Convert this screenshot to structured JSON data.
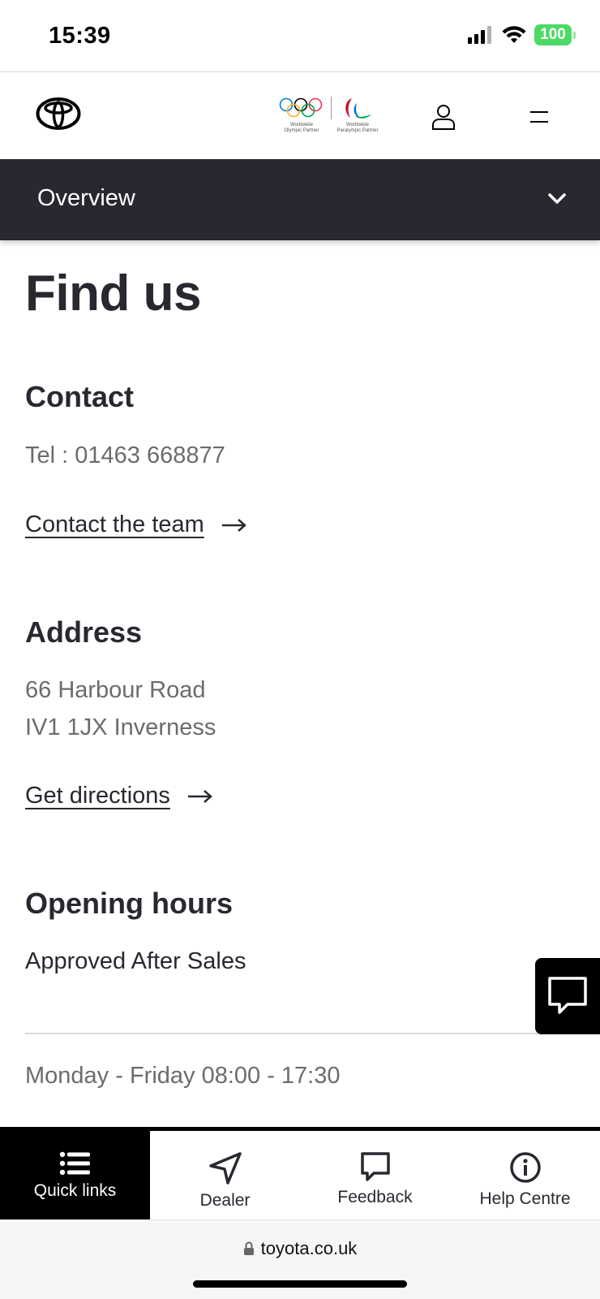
{
  "status_bar": {
    "time": "15:39",
    "battery": "100"
  },
  "header": {
    "olympic_caption_1": "Worldwide",
    "olympic_caption_2": "Olympic Partner",
    "paralympic_caption_1": "Worldwide",
    "paralympic_caption_2": "Paralympic Partner"
  },
  "overview": {
    "label": "Overview"
  },
  "page": {
    "title": "Find us",
    "contact": {
      "heading": "Contact",
      "tel": "Tel : 01463 668877",
      "link": "Contact the team"
    },
    "address": {
      "heading": "Address",
      "line1": "66 Harbour Road",
      "line2": "IV1 1JX Inverness",
      "link": "Get directions"
    },
    "opening_hours": {
      "heading": "Opening hours",
      "department": "Approved After Sales",
      "weekday_hours": "Monday - Friday 08:00 - 17:30"
    }
  },
  "bottom_nav": [
    {
      "label": "Quick links",
      "icon": "list-icon",
      "active": true
    },
    {
      "label": "Dealer",
      "icon": "navigation-arrow-icon",
      "active": false
    },
    {
      "label": "Feedback",
      "icon": "speech-bubble-icon",
      "active": false
    },
    {
      "label": "Help Centre",
      "icon": "info-icon",
      "active": false
    }
  ],
  "browser": {
    "url": "toyota.co.uk"
  },
  "colors": {
    "dark": "#282830",
    "muted_text": "#6b6b70",
    "battery": "#4cd964"
  }
}
